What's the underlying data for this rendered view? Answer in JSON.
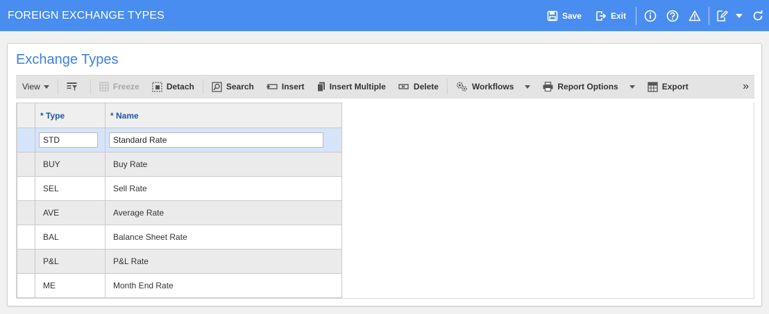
{
  "header": {
    "title": "FOREIGN EXCHANGE TYPES",
    "save_label": "Save",
    "exit_label": "Exit",
    "icons": [
      "save-icon",
      "exit-icon",
      "info-icon",
      "help-icon",
      "warning-icon",
      "edit-icon",
      "chevron-down-icon",
      "refresh-icon"
    ]
  },
  "panel": {
    "title": "Exchange Types"
  },
  "toolbar": {
    "view_label": "View",
    "freeze_label": "Freeze",
    "detach_label": "Detach",
    "search_label": "Search",
    "insert_label": "Insert",
    "insert_multiple_label": "Insert Multiple",
    "delete_label": "Delete",
    "workflows_label": "Workflows",
    "report_options_label": "Report Options",
    "export_label": "Export",
    "more_label": "»"
  },
  "grid": {
    "columns": [
      "* Type",
      "* Name"
    ],
    "active_row": {
      "type": "STD",
      "name": "Standard Rate"
    },
    "rows": [
      {
        "type": "BUY",
        "name": "Buy Rate"
      },
      {
        "type": "SEL",
        "name": "Sell Rate"
      },
      {
        "type": "AVE",
        "name": "Average Rate"
      },
      {
        "type": "BAL",
        "name": "Balance Sheet Rate"
      },
      {
        "type": "P&L",
        "name": "P&L Rate"
      },
      {
        "type": "ME",
        "name": "Month End Rate"
      }
    ]
  },
  "colors": {
    "header_bg": "#4a8df0",
    "panel_title": "#3d7edb",
    "column_header_text": "#1e57a8",
    "active_row_bg": "#d6e4fa"
  }
}
